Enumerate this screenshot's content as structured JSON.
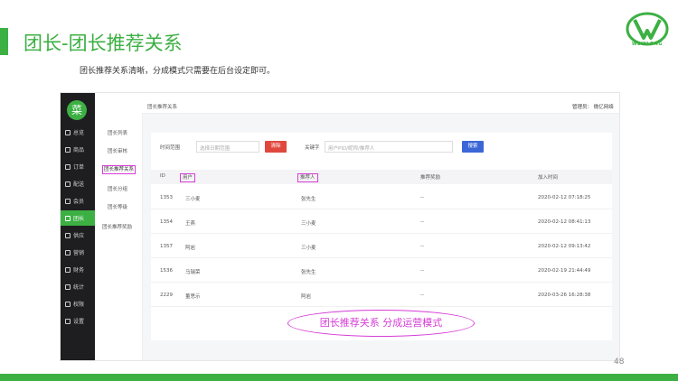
{
  "slide": {
    "title": "团长-团长推荐关系",
    "description": "团长推荐关系清晰，分成模式只需要在后台设定即可。",
    "logo_text": "WEIYLONG",
    "page_number": "48",
    "accent_color": "#3cb043"
  },
  "app": {
    "logo_char": "菜",
    "sidebar": [
      {
        "icon": "home-icon",
        "label": "总览"
      },
      {
        "icon": "goods-icon",
        "label": "商品"
      },
      {
        "icon": "order-icon",
        "label": "订单"
      },
      {
        "icon": "delivery-icon",
        "label": "配送"
      },
      {
        "icon": "member-icon",
        "label": "会员"
      },
      {
        "icon": "leader-icon",
        "label": "团长",
        "active": true
      },
      {
        "icon": "supply-icon",
        "label": "供应"
      },
      {
        "icon": "marketing-icon",
        "label": "营销"
      },
      {
        "icon": "finance-icon",
        "label": "财务"
      },
      {
        "icon": "stats-icon",
        "label": "统计"
      },
      {
        "icon": "permission-icon",
        "label": "权限"
      },
      {
        "icon": "settings-icon",
        "label": "设置"
      }
    ],
    "submenu": [
      {
        "label": "团长列表"
      },
      {
        "label": "团长审核"
      },
      {
        "label": "团长推荐关系",
        "active": true
      },
      {
        "label": "团长分组"
      },
      {
        "label": "团长等级"
      },
      {
        "label": "团长推荐奖励"
      }
    ],
    "breadcrumb": "团长推荐关系",
    "admin": "管理员：  微亿网络",
    "filter": {
      "time_label": "时间范围",
      "date_placeholder": "选择日期范围",
      "clear_label": "清除",
      "keyword_label": "关键字",
      "keyword_placeholder": "用户PID/昵称/推荐人",
      "search_label": "搜索"
    },
    "table": {
      "headers": [
        "ID",
        "用户",
        "推荐人",
        "推荐奖励",
        "加入时间"
      ],
      "rows": [
        {
          "id": "1353",
          "user": "三小麦",
          "referrer": "张先生",
          "reward": "--",
          "time": "2020-02-12 07:18:25"
        },
        {
          "id": "1354",
          "user": "王燕",
          "referrer": "三小麦",
          "reward": "--",
          "time": "2020-02-12 08:41:13"
        },
        {
          "id": "1357",
          "user": "阿岩",
          "referrer": "三小麦",
          "reward": "--",
          "time": "2020-02-12 09:13:42"
        },
        {
          "id": "1536",
          "user": "马瑞荣",
          "referrer": "张先生",
          "reward": "--",
          "time": "2020-02-19 21:44:49"
        },
        {
          "id": "2229",
          "user": "董思示",
          "referrer": "阿岩",
          "reward": "--",
          "time": "2020-03-26 16:28:38"
        }
      ]
    }
  },
  "callout": "团长推荐关系 分成运营模式"
}
